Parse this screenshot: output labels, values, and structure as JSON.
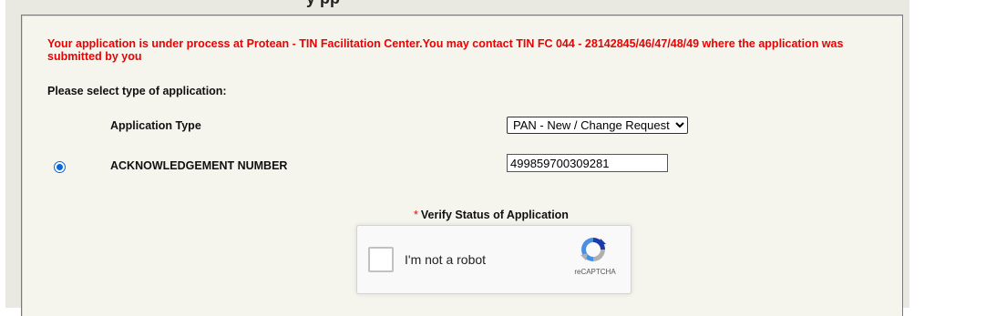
{
  "page": {
    "title_fragment": "y         pp"
  },
  "status": {
    "message": "Your application is under process at Protean - TIN Facilitation Center.You may contact TIN FC 044 - 28142845/46/47/48/49 where the application was submitted by you"
  },
  "form": {
    "select_prompt": "Please select type of application:",
    "application_type_label": "Application Type",
    "application_type_value": "PAN - New / Change Request",
    "acknowledgement_label": "ACKNOWLEDGEMENT NUMBER",
    "acknowledgement_value": "499859700309281",
    "verify_required_mark": "*",
    "verify_label": "Verify Status of Application"
  },
  "captcha": {
    "checkbox_label": "I'm not a robot",
    "brand": "reCAPTCHA"
  },
  "colors": {
    "error": "#ee0000",
    "radio_accent": "#0b66d8",
    "panel_bg": "#f5f5ee"
  },
  "icons": {
    "captcha_logo": "recaptcha-logo-icon",
    "radio": "radio-selected"
  }
}
